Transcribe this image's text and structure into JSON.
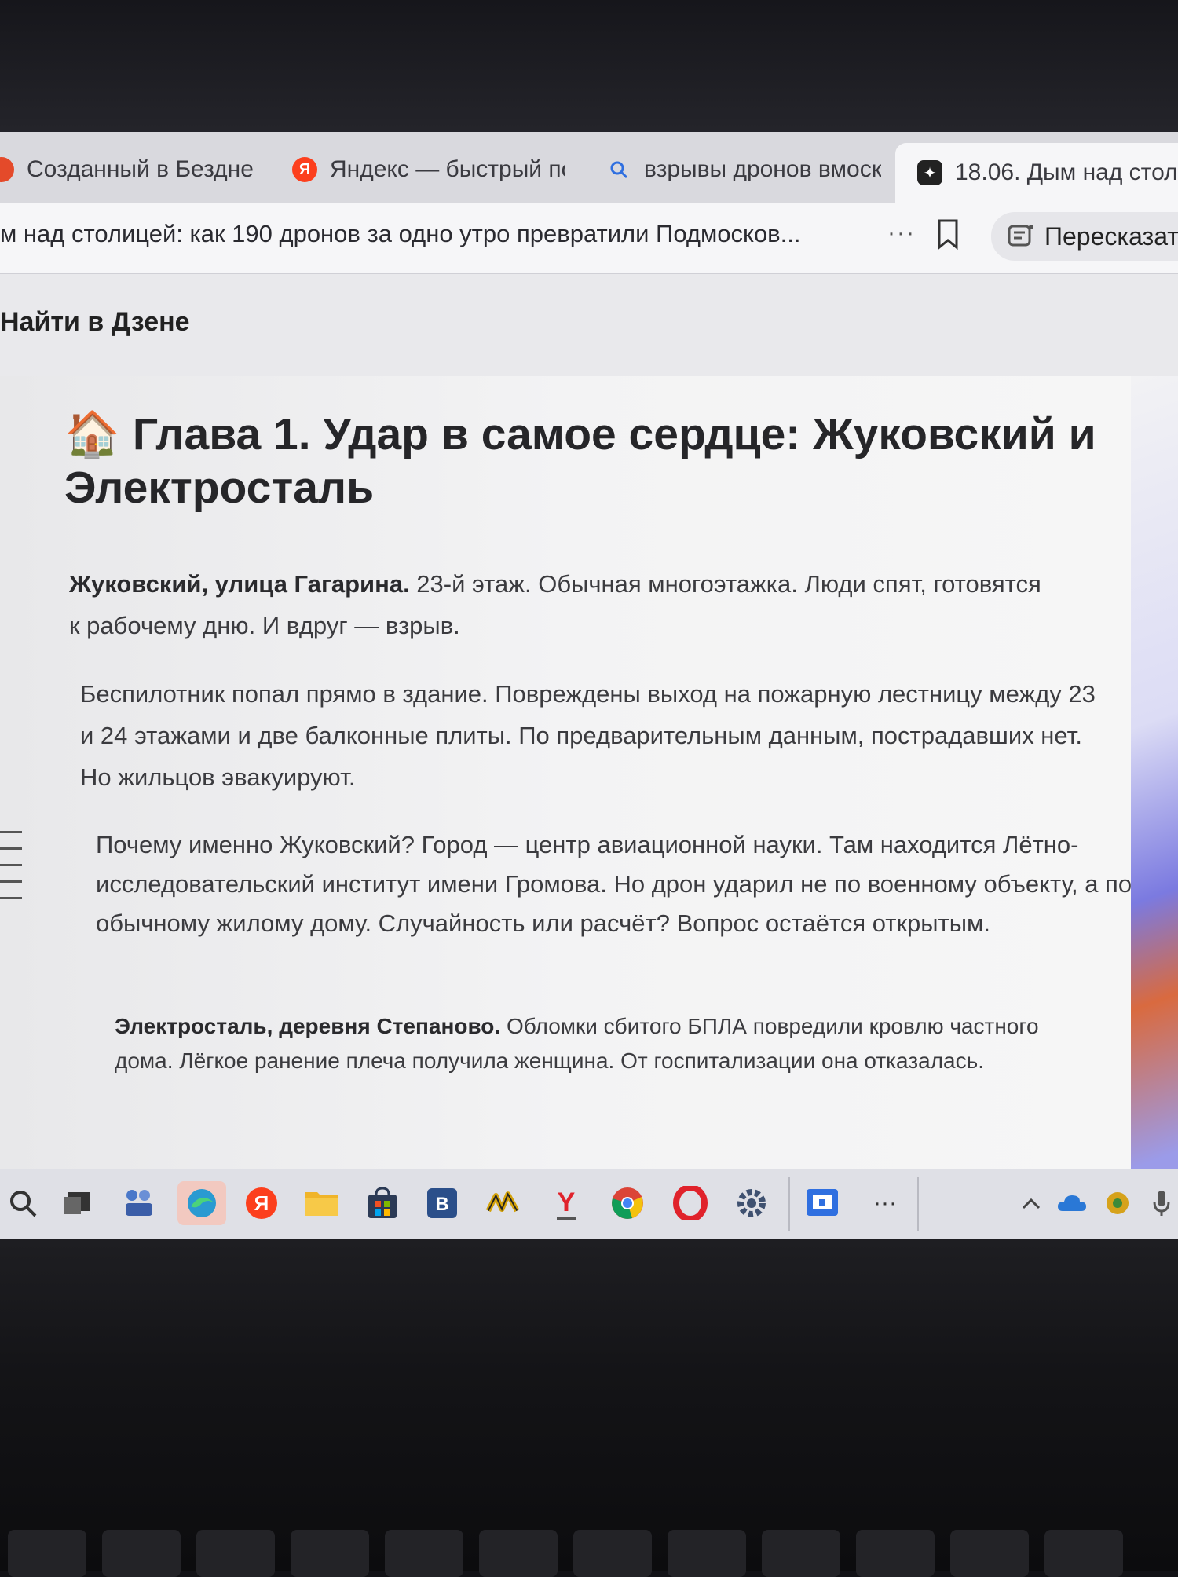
{
  "tabs": [
    {
      "label": "Созданный в Бездне -",
      "icon": "circle-icon"
    },
    {
      "label": "Яндекс — быстрый по",
      "icon": "yandex-icon"
    },
    {
      "label": "взрывы дронов вмоск",
      "icon": "search-icon"
    },
    {
      "label": "18.06. Дым над стол",
      "icon": "sparkle-icon",
      "active": true
    }
  ],
  "address_bar": {
    "page_title": "м над столицей: как 190 дронов за одно утро превратили Подмосков...",
    "more_label": "···",
    "retell_label": "Пересказат"
  },
  "site_header": {
    "search_link": "Найти в Дзене"
  },
  "article": {
    "chapter_emoji": "🏠",
    "chapter_title": "Глава 1. Удар в самое сердце: Жуковский и Электросталь",
    "p1_bold": "Жуковский, улица Гагарина.",
    "p1_text": " 23-й этаж. Обычная многоэтажка. Люди спят, готовятся к рабочему дню. И вдруг — взрыв.",
    "p2_text": "Беспилотник попал прямо в здание. Повреждены выход на пожарную лестницу между 23 и 24 этажами и две балконные плиты. По предварительным данным, пострадавших нет. Но жильцов эвакуируют.",
    "p3_text": "Почему именно Жуковский? Город — центр авиационной науки. Там находится Лётно-исследовательский институт имени Громова. Но дрон ударил не по военному объекту, а по обычному жилому дому. Случайность или расчёт? Вопрос остаётся открытым.",
    "p4_bold": "Электросталь, деревня Степаново.",
    "p4_text": " Обломки сбитого БПЛА повредили кровлю частного дома. Лёгкое ранение плеча получила женщина. От госпитализации она отказалась."
  },
  "taskbar": {
    "yandex_letter": "Я",
    "b_letter": "B",
    "y_letter": "Y",
    "more_label": "···"
  },
  "colors": {
    "yandex_red": "#fc3f1d",
    "opera_red": "#e0222b",
    "accent_blue": "#2f6fe0"
  }
}
